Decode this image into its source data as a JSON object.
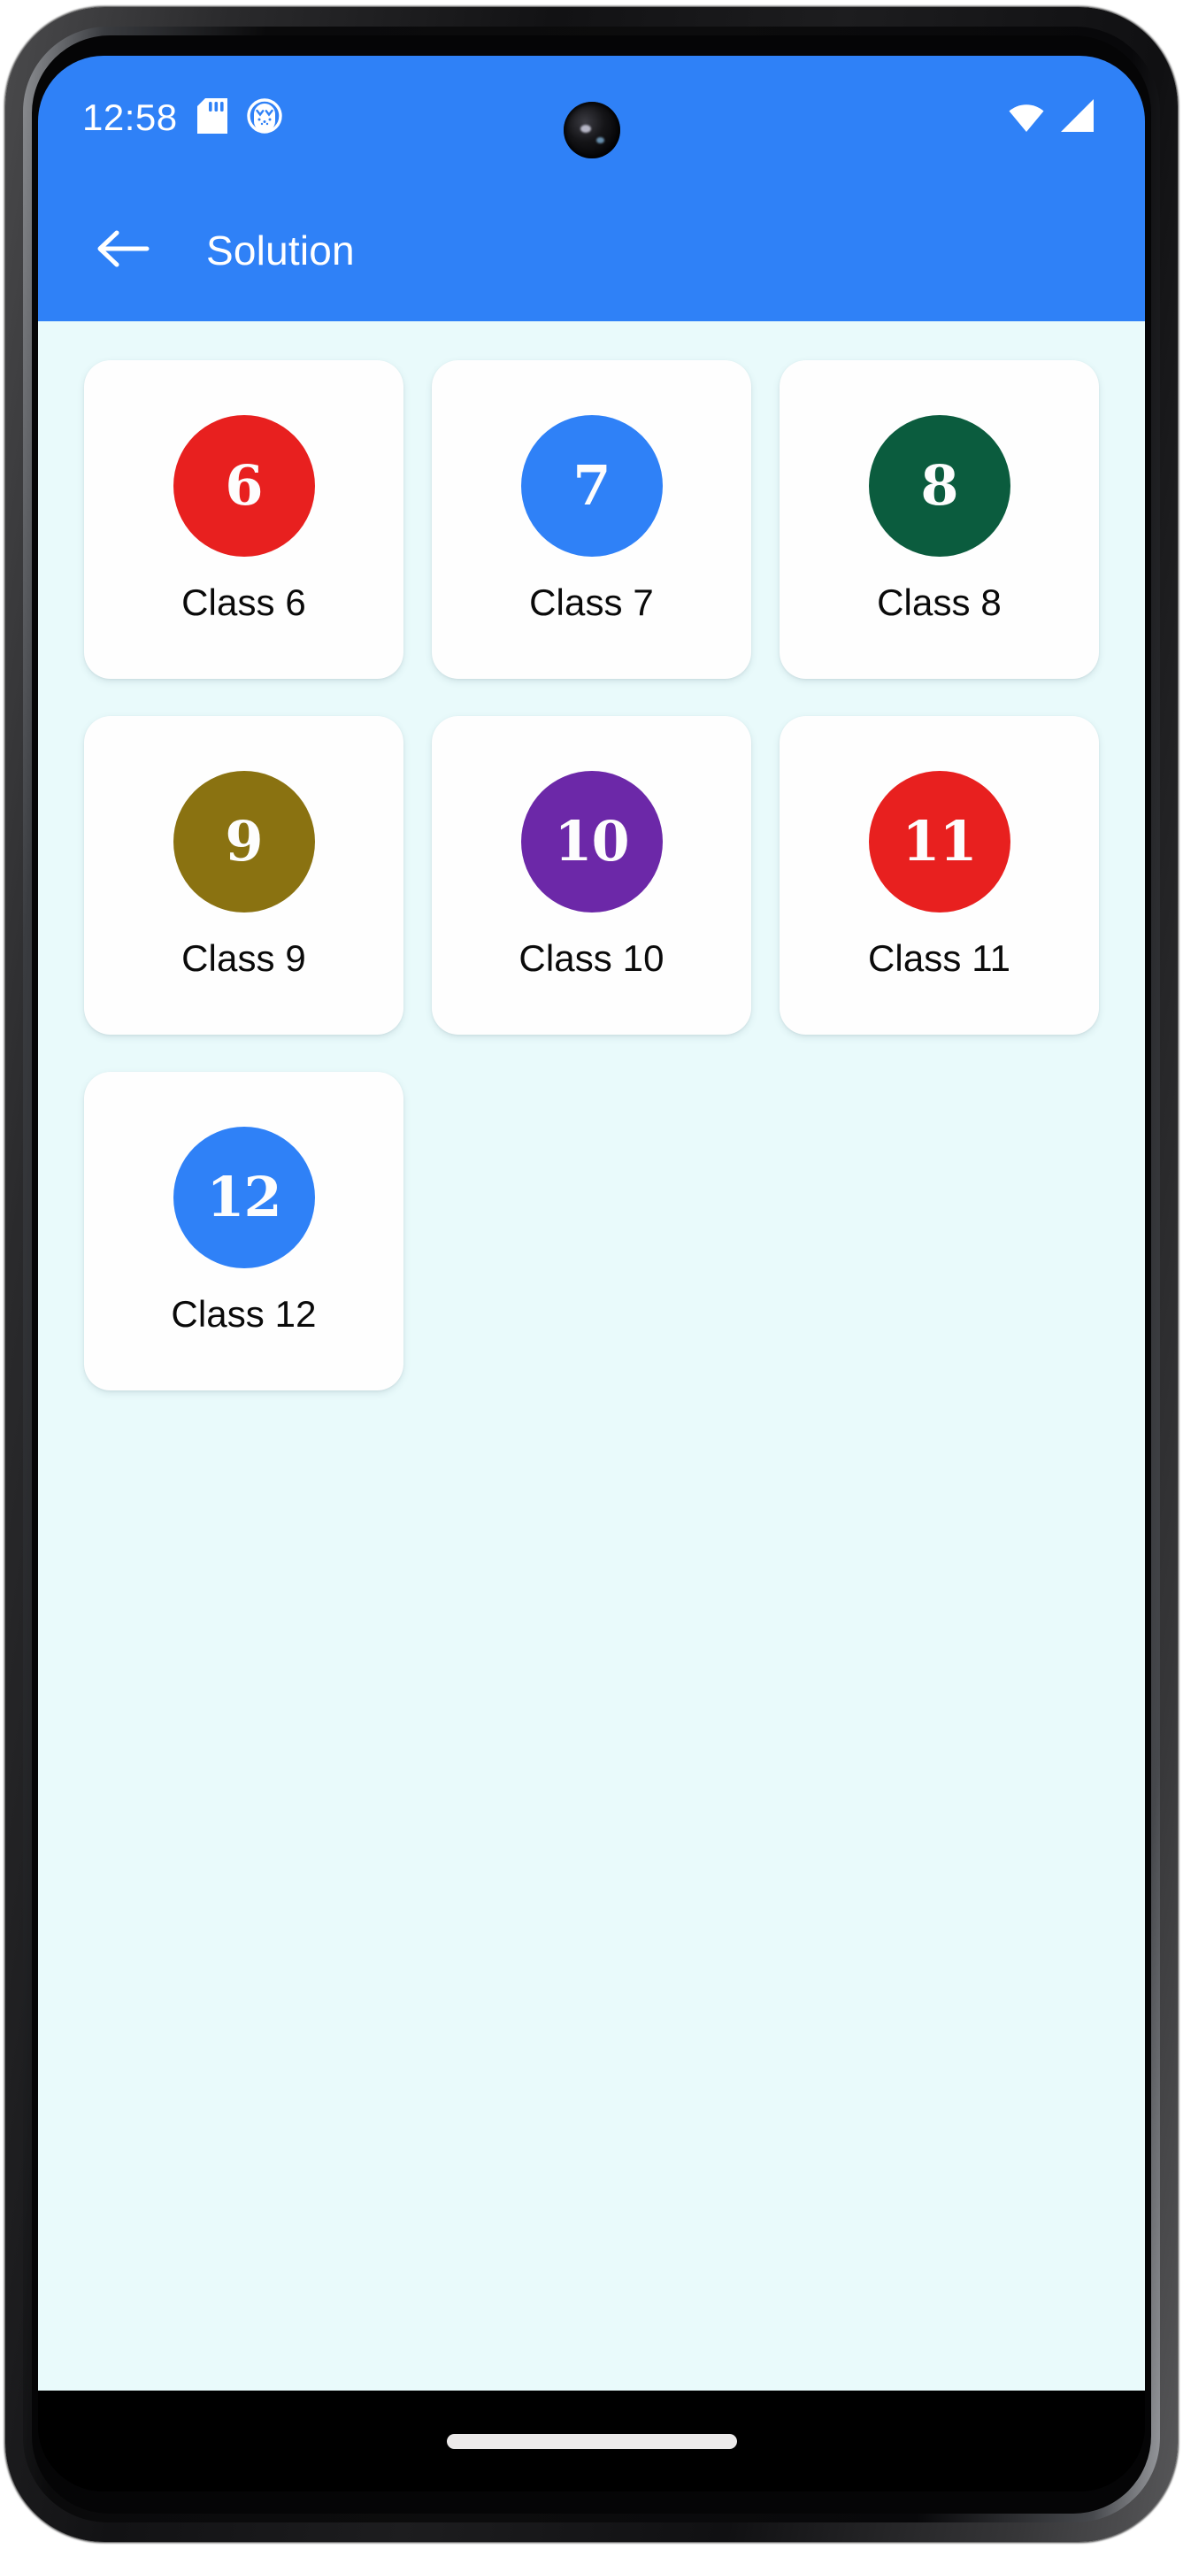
{
  "status_bar": {
    "time": "12:58",
    "icons": [
      "sd-card-icon",
      "app-notification-icon"
    ],
    "right_icons": [
      "wifi-icon",
      "cellular-signal-icon"
    ],
    "background_color": "#2f81f7"
  },
  "app_bar": {
    "back_label": "back-arrow",
    "title": "Solution",
    "background_color": "#2f81f7",
    "text_color": "#ffffff"
  },
  "content": {
    "background_color": "#e9fafb",
    "cards": [
      {
        "number": "6",
        "label": "Class 6",
        "color": "#e8201f"
      },
      {
        "number": "7",
        "label": "Class 7",
        "color": "#2f81f7"
      },
      {
        "number": "8",
        "label": "Class 8",
        "color": "#0b5c3e"
      },
      {
        "number": "9",
        "label": "Class 9",
        "color": "#8a7211"
      },
      {
        "number": "10",
        "label": "Class 10",
        "color": "#6c28a8"
      },
      {
        "number": "11",
        "label": "Class 11",
        "color": "#e8201f"
      },
      {
        "number": "12",
        "label": "Class 12",
        "color": "#2f81f7"
      }
    ]
  },
  "gesture_nav": {
    "handle": "home-gesture-pill",
    "background_color": "#000000"
  }
}
